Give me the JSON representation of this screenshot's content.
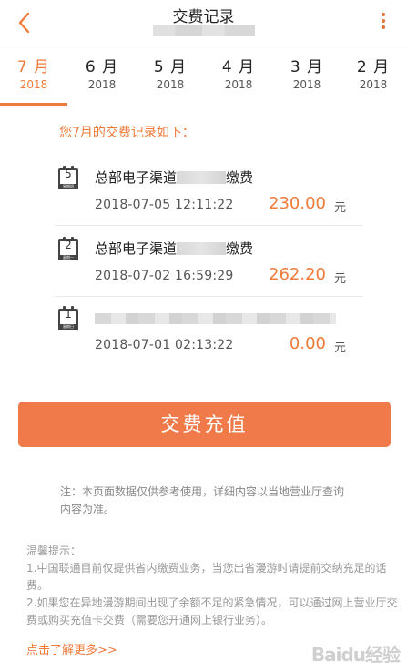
{
  "header": {
    "title": "交费记录",
    "back_icon": "chevron-left-icon",
    "menu_icon": "more-vertical-icon",
    "accent": "#f07a3a"
  },
  "tabs": [
    {
      "month": "7 月",
      "year": "2018",
      "active": true
    },
    {
      "month": "6 月",
      "year": "2018"
    },
    {
      "month": "5 月",
      "year": "2018"
    },
    {
      "month": "4 月",
      "year": "2018"
    },
    {
      "month": "3 月",
      "year": "2018"
    },
    {
      "month": "2 月",
      "year": "2018"
    }
  ],
  "section_title": "您7月的交费记录如下：",
  "records": [
    {
      "day": "5",
      "weekday": "星期四",
      "name_prefix": "总部电子渠道",
      "name_suffix": "缴费",
      "datetime": "2018-07-05 12:11:22",
      "amount": "230.00",
      "unit": "元"
    },
    {
      "day": "2",
      "weekday": "星期一",
      "name_prefix": "总部电子渠道",
      "name_suffix": "缴费",
      "datetime": "2018-07-02 16:59:29",
      "amount": "262.20",
      "unit": "元"
    },
    {
      "day": "1",
      "weekday": "星期日",
      "name_prefix": "",
      "name_suffix": "",
      "datetime": "2018-07-01 02:13:22",
      "amount": "0.00",
      "unit": "元"
    }
  ],
  "recharge_button": "交费充值",
  "note": "注：本页面数据仅供参考使用，详细内容以当地营业厅查询内容为准。",
  "tips": {
    "heading": "温馨提示：",
    "items": [
      "1.中国联通目前仅提供省内缴费业务，当您出省漫游时请提前交纳充足的话费。",
      "2.如果您在异地漫游期间出现了余额不足的紧急情况，可以通过网上营业厅交费或购买充值卡交费（需要您开通网上银行业务）。"
    ]
  },
  "learn_more": "点击了解更多>>",
  "watermark": "Baidu经验"
}
